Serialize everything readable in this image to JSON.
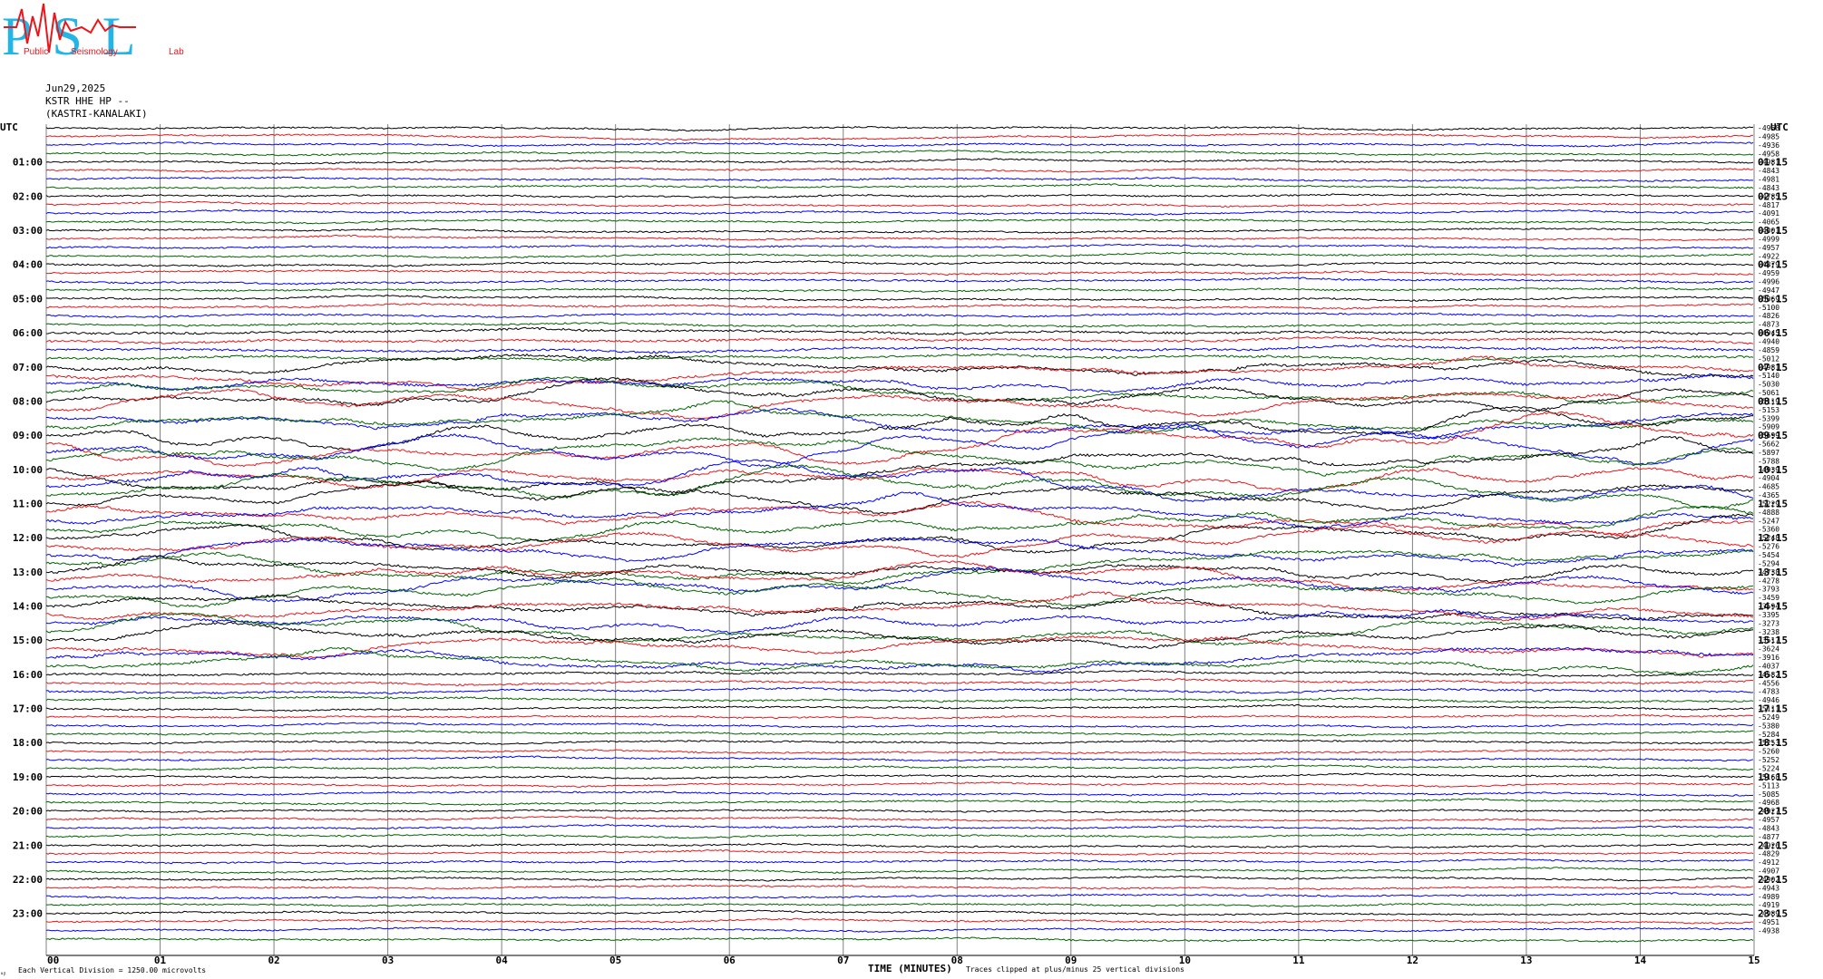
{
  "logo": {
    "letters": "PSL",
    "text_a": "Public",
    "text_b": "Seismology",
    "text_c": "Lab",
    "colors": {
      "red": "#e8171c",
      "cyan": "#23b5e6"
    }
  },
  "header": {
    "date": "Jun29,2025",
    "station": "KSTR HHE HP --",
    "location": "(KASTRI-KANALAKI)"
  },
  "utc_left": "UTC",
  "utc_right": "UTC",
  "hour_labels_left": [
    "01:00",
    "02:00",
    "03:00",
    "04:00",
    "05:00",
    "06:00",
    "07:00",
    "08:00",
    "09:00",
    "10:00",
    "11:00",
    "12:00",
    "13:00",
    "14:00",
    "15:00",
    "16:00",
    "17:00",
    "18:00",
    "19:00",
    "20:00",
    "21:00",
    "22:00",
    "23:00"
  ],
  "hour_labels_right": [
    "01:15",
    "02:15",
    "03:15",
    "04:15",
    "05:15",
    "06:15",
    "07:15",
    "08:15",
    "09:15",
    "10:15",
    "11:15",
    "12:15",
    "13:15",
    "14:15",
    "15:15",
    "16:15",
    "17:15",
    "18:15",
    "19:15",
    "20:15",
    "21:15",
    "22:15",
    "23:15"
  ],
  "offset_labels": [
    "-4958",
    "-4985",
    "-4936",
    "-4958",
    "-4981",
    "-4843",
    "-4981",
    "-4843",
    "-4785",
    "-4817",
    "-4091",
    "-4065",
    "-4001",
    "-4999",
    "-4957",
    "-4922",
    "-4879",
    "-4959",
    "-4996",
    "-4947",
    "-5069",
    "-5100",
    "-4826",
    "-4873",
    "-4945",
    "-4940",
    "-4859",
    "-5012",
    "-4981",
    "-5140",
    "-5030",
    "-5061",
    "-5119",
    "-5153",
    "-5399",
    "-5909",
    "-5699",
    "-5662",
    "-5897",
    "-5788",
    "-4939",
    "-4904",
    "-4685",
    "-4365",
    "-5229",
    "-4888",
    "-5247",
    "-5360",
    "-5248",
    "-5276",
    "-5454",
    "-5294",
    "-4738",
    "-4278",
    "-3793",
    "-3459",
    "-3594",
    "-3395",
    "-3273",
    "-3238",
    "-3517",
    "-3624",
    "-3916",
    "-4037",
    "-4582",
    "-4556",
    "-4783",
    "-4946",
    "-5111",
    "-5249",
    "-5380",
    "-5284",
    "-5253",
    "-5260",
    "-5252",
    "-5224",
    "-5168",
    "-5113",
    "-5085",
    "-4968",
    "-4927",
    "-4957",
    "-4843",
    "-4877",
    "-4926",
    "-4829",
    "-4912",
    "-4907",
    "-4902",
    "-4943",
    "-4989",
    "-4919",
    "-4989",
    "-4951",
    "-4938"
  ],
  "x_tick_labels": [
    "00",
    "01",
    "02",
    "03",
    "04",
    "05",
    "06",
    "07",
    "08",
    "09",
    "10",
    "11",
    "12",
    "13",
    "14",
    "15"
  ],
  "footer": {
    "vertical_division": "Each Vertical Division = 1250.00 microvolts",
    "axis_title": "TIME (MINUTES)",
    "clip_note": "Traces clipped at plus/minus 25 vertical divisions",
    "corner_mark": "ᵤᵦ"
  },
  "colors": {
    "trace_cycle": [
      "#000000",
      "#e8171c",
      "#0000ff",
      "#006400"
    ],
    "grid": "#808080"
  },
  "chart_data": {
    "type": "line",
    "title": "",
    "xlabel": "TIME (MINUTES)",
    "ylabel": "",
    "x_range_minutes": [
      0,
      15
    ],
    "row_count": 96,
    "row_minutes": 15,
    "color_cycle_order": [
      "black",
      "red",
      "blue",
      "green"
    ],
    "grid": true,
    "vertical_division_microvolts": 1250.0,
    "clip_divisions": 25,
    "activity_by_hour": [
      1,
      1,
      1,
      1,
      1.1,
      1.1,
      1.4,
      1.6,
      2.2,
      3.0,
      2.8,
      2.4,
      2.2,
      2.0,
      1.9,
      1.6,
      1.2,
      1.0,
      1.0,
      1.0,
      1.0,
      1.0,
      1.0,
      1.0
    ]
  }
}
